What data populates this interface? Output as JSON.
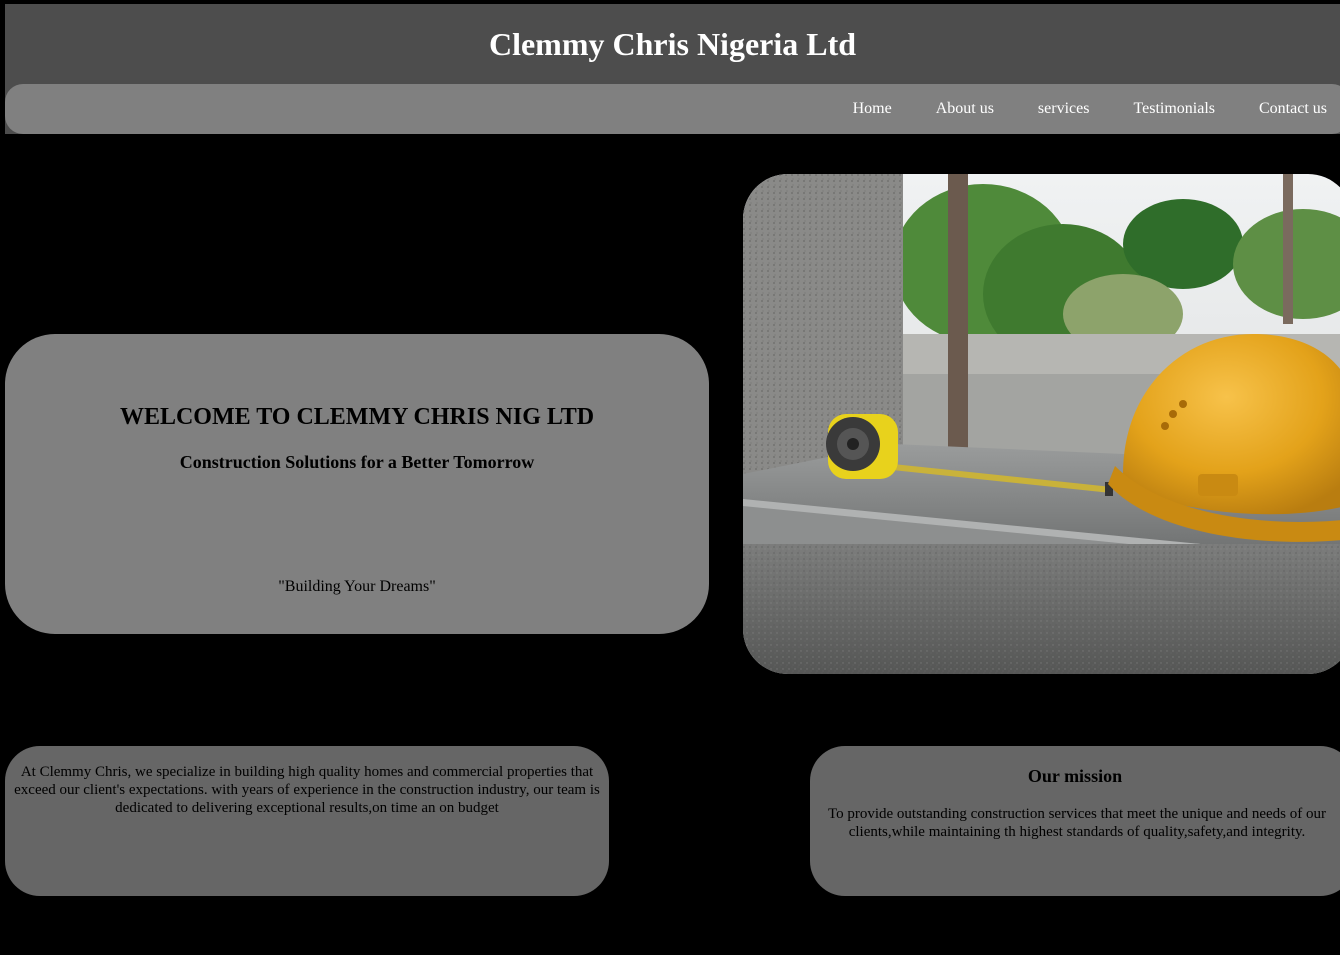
{
  "header": {
    "title": "Clemmy Chris Nigeria Ltd"
  },
  "nav": {
    "items": [
      {
        "label": "Home"
      },
      {
        "label": "About us"
      },
      {
        "label": "services"
      },
      {
        "label": "Testimonials"
      },
      {
        "label": "Contact us"
      }
    ]
  },
  "hero": {
    "heading": "WELCOME TO CLEMMY CHRIS NIG LTD",
    "subheading": "Construction Solutions for a Better Tomorrow",
    "tagline": "\"Building Your Dreams\""
  },
  "about": {
    "text": "At Clemmy Chris, we specialize in building high quality homes and commercial properties that exceed our client's expectations. with years of experience in the construction industry, our team is dedicated to delivering exceptional results,on time an on budget"
  },
  "mission": {
    "title": "Our mission",
    "text": "To provide outstanding construction services that meet the unique and needs of our clients,while maintaining th highest standards of quality,safety,and integrity."
  },
  "colors": {
    "background": "#000000",
    "header": "#4d4d4d",
    "navbar": "#808080",
    "hero_card": "#808080",
    "info_card": "#666666",
    "helmet": "#e3a21a"
  },
  "icons": {
    "photo": "construction-helmet-tape-measure-photo"
  }
}
